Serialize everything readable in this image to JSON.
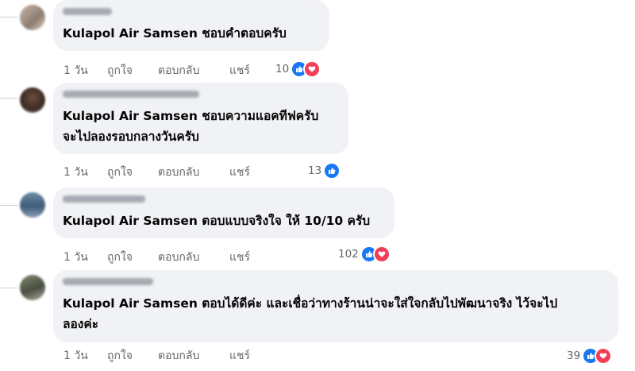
{
  "actions": {
    "time": "1 วัน",
    "like": "ถูกใจ",
    "reply": "ตอบกลับ",
    "share": "แชร์"
  },
  "colors": {
    "like_blue": "#1877f2",
    "love_red": "#f33e58",
    "bubble_bg": "#f0f2f5"
  },
  "comments": [
    {
      "text": [
        "Kulapol Air Samsen ชอบคำตอบครับ"
      ],
      "reaction_count": "10",
      "reactions": [
        "like-icon",
        "love-icon"
      ]
    },
    {
      "text": [
        "Kulapol Air Samsen ชอบความแอคทีฟครับ",
        "จะไปลองรอบกลางวันครับ"
      ],
      "reaction_count": "13",
      "reactions": [
        "like-icon"
      ]
    },
    {
      "text": [
        "Kulapol Air Samsen ตอบแบบจริงใจ ให้ 10/10 ครับ"
      ],
      "reaction_count": "102",
      "reactions": [
        "like-icon",
        "love-icon"
      ]
    },
    {
      "text": [
        "Kulapol Air Samsen ตอบได้ดีค่ะ และเชื่อว่าทางร้านน่าจะใส่ใจกลับไปพัฒนาจริง ไว้จะไป",
        "ลองค่ะ"
      ],
      "reaction_count": "39",
      "reactions": [
        "like-icon",
        "love-icon"
      ]
    }
  ]
}
